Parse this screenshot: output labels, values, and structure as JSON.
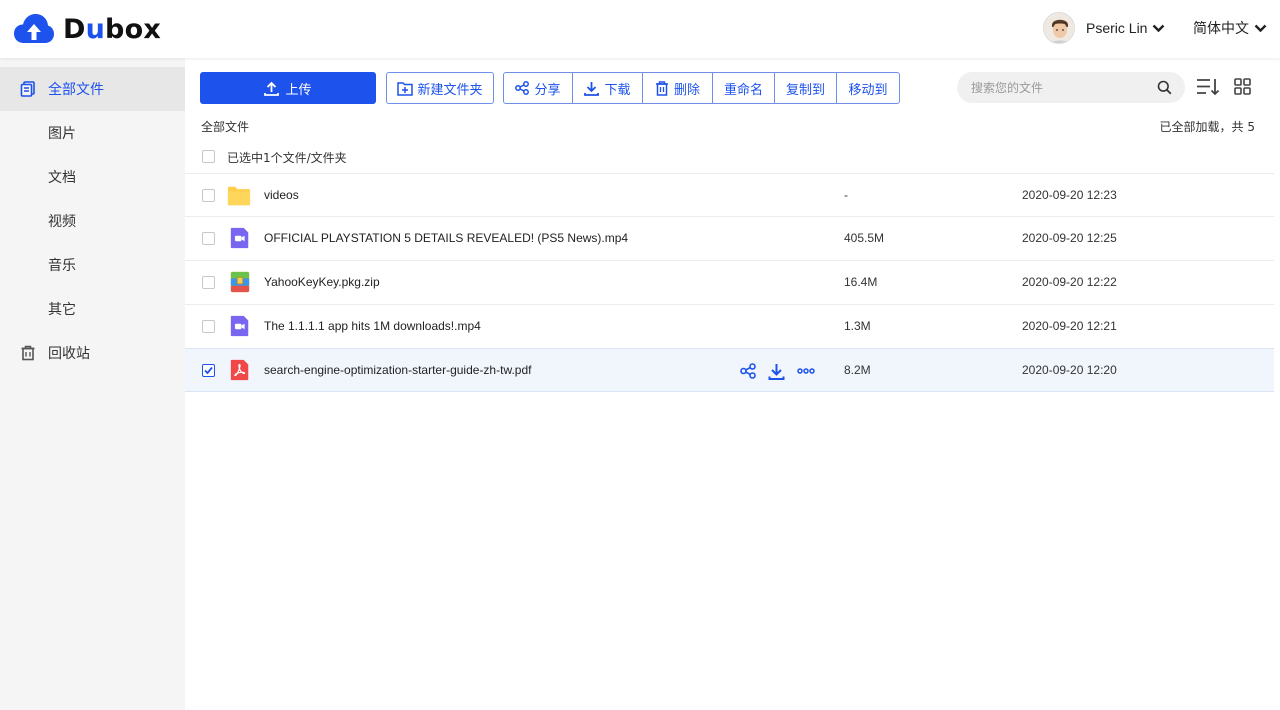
{
  "app": {
    "brand_prefix": "D",
    "brand_u": "u",
    "brand_suffix": "box",
    "brand_color": "#1d52ec"
  },
  "header": {
    "user_name": "Pseric Lin",
    "language": "简体中文"
  },
  "sidebar": {
    "items": [
      {
        "label": "全部文件",
        "icon": "files-icon",
        "active": true
      },
      {
        "label": "图片",
        "icon": ""
      },
      {
        "label": "文档",
        "icon": ""
      },
      {
        "label": "视频",
        "icon": ""
      },
      {
        "label": "音乐",
        "icon": ""
      },
      {
        "label": "其它",
        "icon": ""
      },
      {
        "label": "回收站",
        "icon": "trash-icon"
      }
    ]
  },
  "toolbar": {
    "upload": "上传",
    "new_folder": "新建文件夹",
    "share": "分享",
    "download": "下载",
    "delete": "删除",
    "rename": "重命名",
    "copy_to": "复制到",
    "move_to": "移动到"
  },
  "search": {
    "placeholder": "搜索您的文件"
  },
  "breadcrumb": "全部文件",
  "load_status": "已全部加载，共 5",
  "selection_label": "已选中1个文件/文件夹",
  "files": [
    {
      "name": "videos",
      "size": "-",
      "date": "2020-09-20 12:23",
      "type": "folder",
      "selected": false
    },
    {
      "name": "OFFICIAL PLAYSTATION 5 DETAILS REVEALED! (PS5 News).mp4",
      "size": "405.5M",
      "date": "2020-09-20 12:25",
      "type": "video",
      "selected": false
    },
    {
      "name": "YahooKeyKey.pkg.zip",
      "size": "16.4M",
      "date": "2020-09-20 12:22",
      "type": "archive",
      "selected": false
    },
    {
      "name": "The 1.1.1.1 app hits 1M downloads!.mp4",
      "size": "1.3M",
      "date": "2020-09-20 12:21",
      "type": "video",
      "selected": false
    },
    {
      "name": "search-engine-optimization-starter-guide-zh-tw.pdf",
      "size": "8.2M",
      "date": "2020-09-20 12:20",
      "type": "pdf",
      "selected": true
    }
  ]
}
